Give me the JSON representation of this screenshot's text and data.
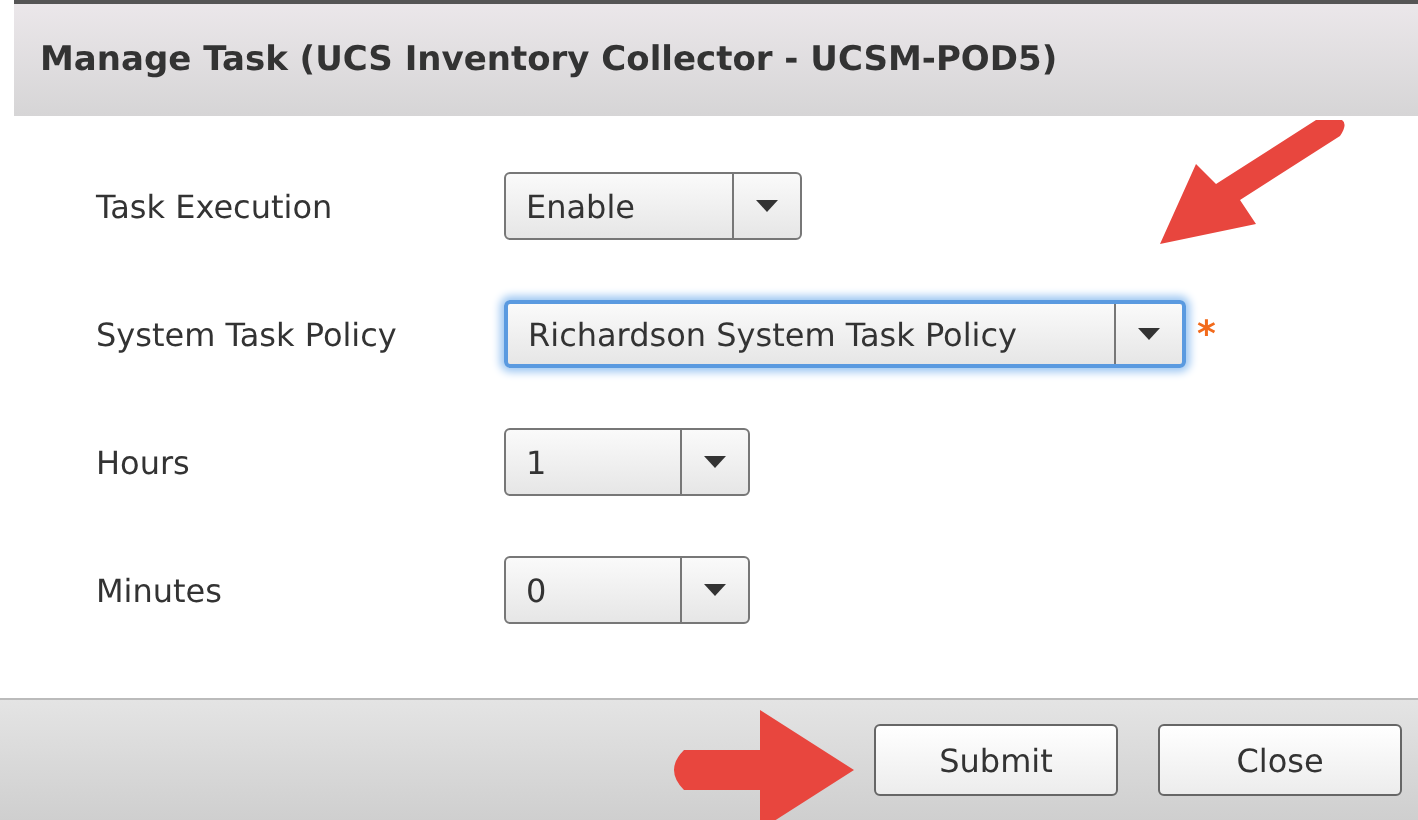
{
  "dialog": {
    "title": "Manage Task (UCS Inventory Collector - UCSM-POD5)"
  },
  "fields": [
    {
      "label": "Task Execution",
      "value": "Enable",
      "focused": false
    },
    {
      "label": "System Task Policy",
      "value": "Richardson System Task Policy",
      "focused": true,
      "required_mark": "*"
    },
    {
      "label": "Hours",
      "value": "1",
      "focused": false
    },
    {
      "label": "Minutes",
      "value": "0",
      "focused": false
    }
  ],
  "buttons": [
    "Submit",
    "Close"
  ]
}
